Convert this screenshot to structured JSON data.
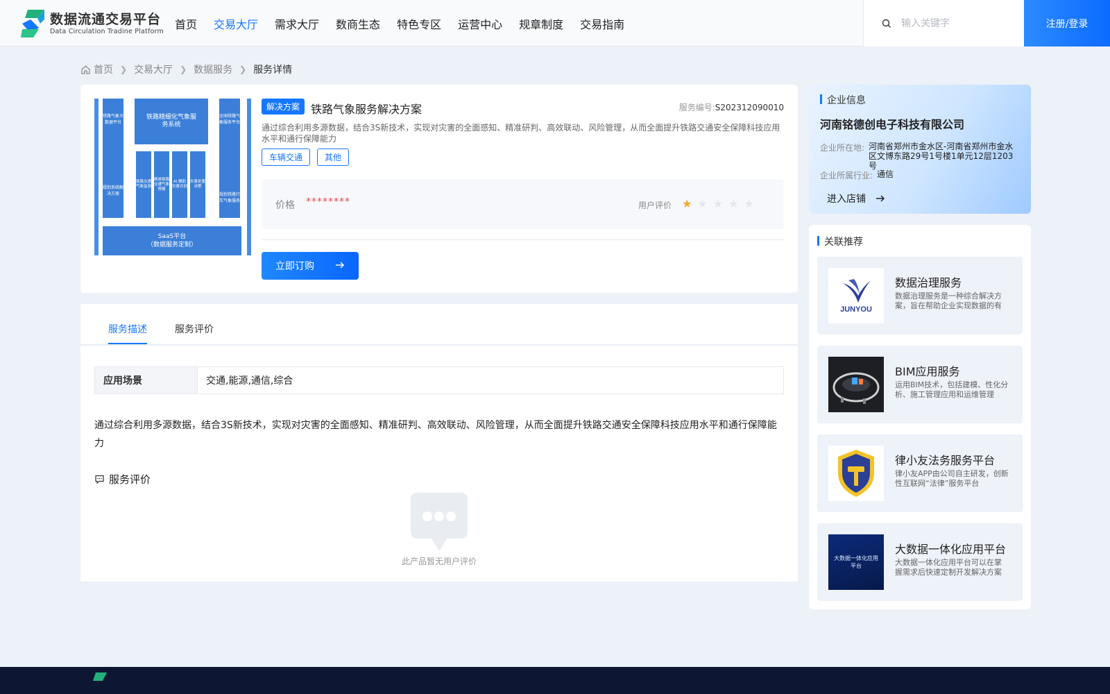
{
  "header": {
    "logo_title": "数据流通交易平台",
    "logo_subtitle": "Data Circulation Tradine Platform",
    "nav": [
      "首页",
      "交易大厅",
      "需求大厅",
      "数商生态",
      "特色专区",
      "运营中心",
      "规章制度",
      "交易指南"
    ],
    "active_nav": "交易大厅",
    "search_placeholder": "输入关键字",
    "login_label": "注册/登录"
  },
  "breadcrumb": [
    "首页",
    "交易大厅",
    "数据服务",
    "服务详情"
  ],
  "service": {
    "type_tag": "解决方案",
    "title": "铁路气象服务解决方案",
    "no_label": "服务编号:",
    "no_value": "S202312090010",
    "description": "通过综合利用多源数据，结合3S新技术，实现对灾害的全面感知、精准研判、高效联动、风险管理，从而全面提升铁路交通安全保障科技应用水平和通行保障能力",
    "tags": [
      "车辆交通",
      "其他"
    ],
    "price_label": "价格",
    "price_value": "********",
    "rating_label": "用户评价",
    "rating": 1,
    "rating_max": 5,
    "buy_label": "立即订购",
    "diagram": {
      "left_top": "铁路气象大数据平台",
      "left_bottom": "规划系统解决方案",
      "center_top": "铁路精细化气象服务系统",
      "center_cols": [
        "铁路交通气象监测",
        "精准铁路交通气象预报",
        "AI 辅助灾害识别",
        "灾害处置决策"
      ],
      "right_top": "全国铁路气象服务平台",
      "right_bottom": "规划铁路行车气象服务",
      "bottom_title": "SaaS平台",
      "bottom_sub": "（数据服务定制）"
    }
  },
  "detail": {
    "tabs": [
      "服务描述",
      "服务评价"
    ],
    "scene_label": "应用场景",
    "scene_value": "交通,能源,通信,综合",
    "long_description": "通过综合利用多源数据，结合3S新技术，实现对灾害的全面感知、精准研判、高效联动、风险管理，从而全面提升铁路交通安全保障科技应用水平和通行保障能力",
    "review_title": "服务评价",
    "empty_text": "此产品暂无用户评价"
  },
  "company": {
    "section_title": "企业信息",
    "name": "河南铭德创电子科技有限公司",
    "location_label": "企业所在地:",
    "location_value": "河南省郑州市金水区-河南省郑州市金水区文博东路29号1号楼1单元12层1203号",
    "industry_label": "企业所属行业:",
    "industry_value": "通信",
    "shop_label": "进入店铺"
  },
  "recommend": {
    "section_title": "关联推荐",
    "items": [
      {
        "title": "数据治理服务",
        "desc": "数据治理服务是一种综合解决方案，旨在帮助企业实现数据的有效管理",
        "thumb_text": "JUNYOU"
      },
      {
        "title": "BIM应用服务",
        "desc": "运用BIM技术，包括建模、性化分析、施工管理应用和运维管理",
        "thumb_text": ""
      },
      {
        "title": "律小友法务服务平台",
        "desc": "律小友APP由公司自主研发，创新性互联网“法律”服务平台",
        "thumb_text": ""
      },
      {
        "title": "大数据一体化应用平台",
        "desc": "大数据一体化应用平台可以在掌握需求后快速定制开发解决方案",
        "thumb_text": "大数据一体化应用平台"
      }
    ]
  },
  "colors": {
    "accent": "#1677ff",
    "price": "#f04848",
    "star": "#f5a623",
    "footer": "#0d1733"
  }
}
